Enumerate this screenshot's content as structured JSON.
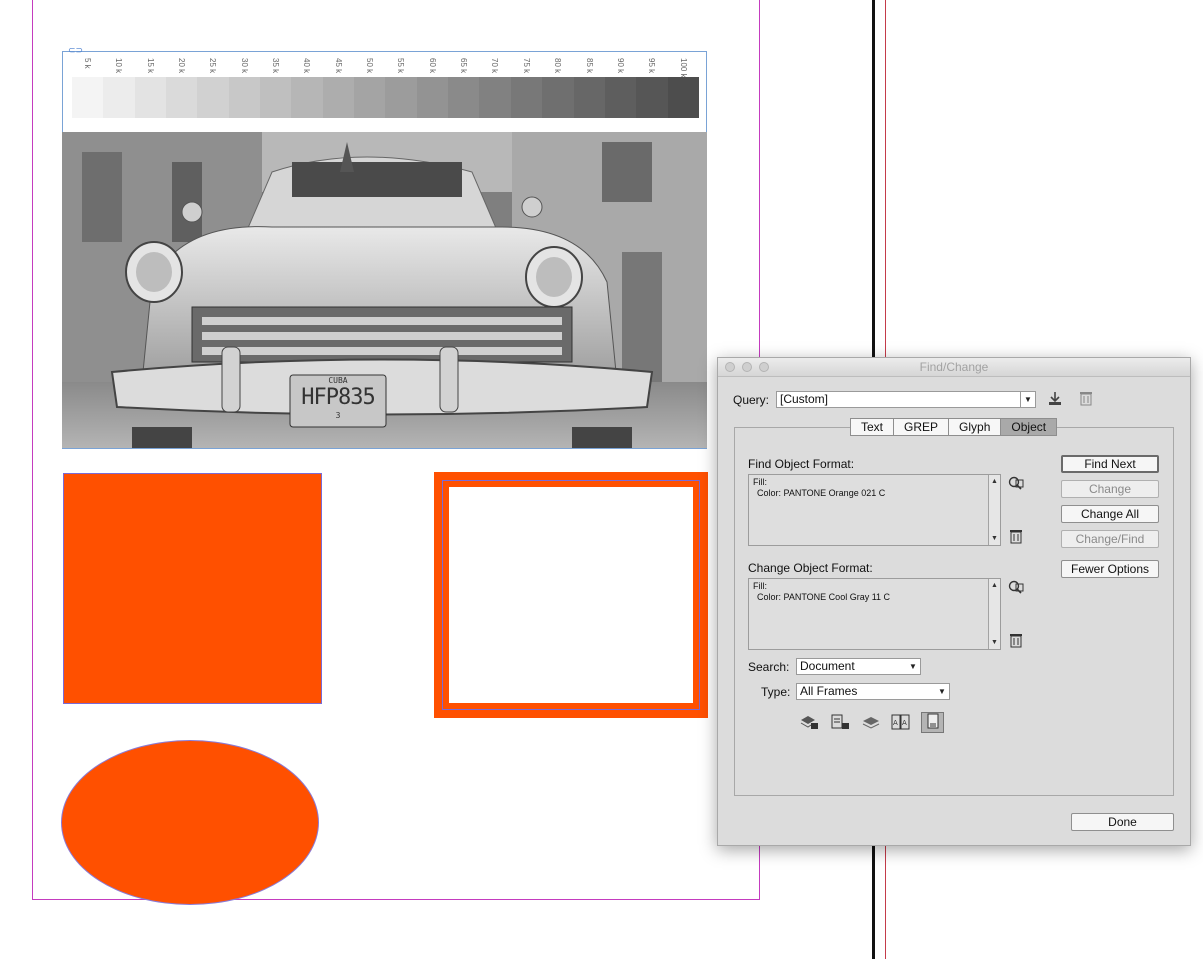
{
  "document": {
    "gray_strip_labels": [
      "5 k",
      "10 k",
      "15 k",
      "20 k",
      "25 k",
      "30 k",
      "35 k",
      "40 k",
      "45 k",
      "50 k",
      "55 k",
      "60 k",
      "65 k",
      "70 k",
      "75 k",
      "80 k",
      "85 k",
      "90 k",
      "95 k",
      "100 k"
    ],
    "gray_strip_colors": [
      "#f4f4f4",
      "#ececec",
      "#e3e3e3",
      "#dadada",
      "#d1d1d1",
      "#c8c8c8",
      "#bfbfbf",
      "#b6b6b6",
      "#adadad",
      "#a4a4a4",
      "#9c9c9c",
      "#939393",
      "#8a8a8a",
      "#818181",
      "#787878",
      "#6f6f6f",
      "#676767",
      "#5e5e5e",
      "#565656",
      "#4d4d4d"
    ],
    "license_plate_top": "CUBA",
    "license_plate": "HFP835",
    "license_plate_bottom": "3",
    "accent_color": "#ff5000"
  },
  "dialog": {
    "title": "Find/Change",
    "query_label": "Query:",
    "query_value": "[Custom]",
    "tabs": [
      {
        "label": "Text",
        "active": false
      },
      {
        "label": "GREP",
        "active": false
      },
      {
        "label": "Glyph",
        "active": false
      },
      {
        "label": "Object",
        "active": true
      }
    ],
    "find_label": "Find Object Format:",
    "find_lines": [
      "Fill:",
      "Color: PANTONE Orange 021 C"
    ],
    "change_label": "Change Object Format:",
    "change_lines": [
      "Fill:",
      "Color: PANTONE Cool Gray 11 C"
    ],
    "search_label": "Search:",
    "search_value": "Document",
    "type_label": "Type:",
    "type_value": "All Frames",
    "buttons": {
      "find_next": "Find Next",
      "change": "Change",
      "change_all": "Change All",
      "change_find": "Change/Find",
      "fewer_options": "Fewer Options",
      "done": "Done"
    },
    "option_icons": [
      "include-locked-layers-icon",
      "include-locked-objects-icon",
      "include-hidden-layers-icon",
      "include-master-pages-icon",
      "include-footnotes-icon"
    ]
  }
}
